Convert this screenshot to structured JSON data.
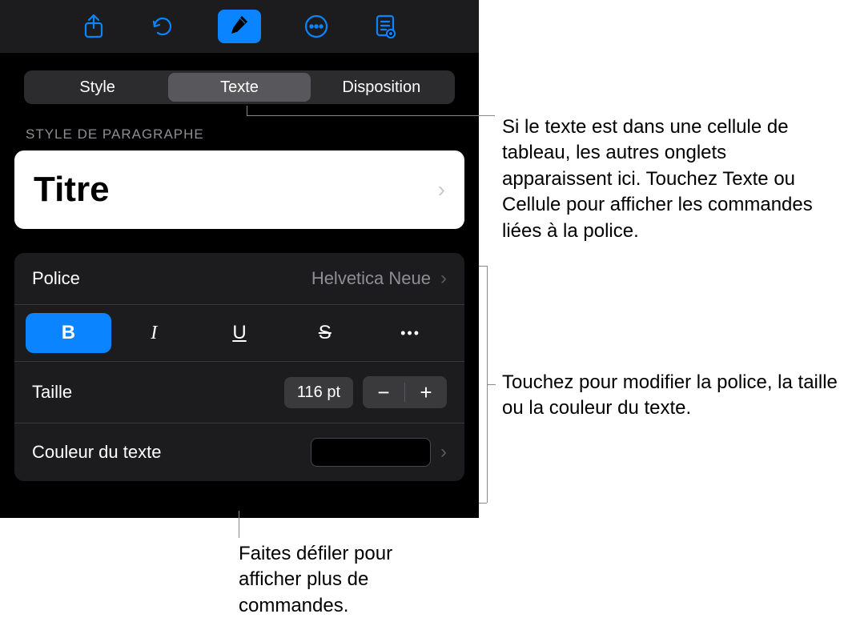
{
  "toolbar": {
    "share_icon": "share",
    "undo_icon": "undo",
    "format_icon": "paintbrush",
    "more_icon": "more",
    "view_icon": "view"
  },
  "tabs": {
    "style": "Style",
    "text": "Texte",
    "layout": "Disposition"
  },
  "paragraph_style": {
    "header": "STYLE DE PARAGRAPHE",
    "value": "Titre"
  },
  "font": {
    "label": "Police",
    "value": "Helvetica Neue"
  },
  "format_buttons": {
    "bold": "B",
    "italic": "I",
    "underline": "U",
    "strike": "S",
    "more": "•••"
  },
  "size": {
    "label": "Taille",
    "value": "116 pt",
    "minus": "−",
    "plus": "+"
  },
  "text_color": {
    "label": "Couleur du texte",
    "value": "#000000"
  },
  "callouts": {
    "tabs": "Si le texte est dans une cellule de tableau, les autres onglets apparaissent ici. Touchez Texte ou Cellule pour afficher les commandes liées à la police.",
    "font_block": "Touchez pour modifier la police, la taille ou la couleur du texte.",
    "scroll": "Faites défiler pour afficher plus de commandes."
  }
}
